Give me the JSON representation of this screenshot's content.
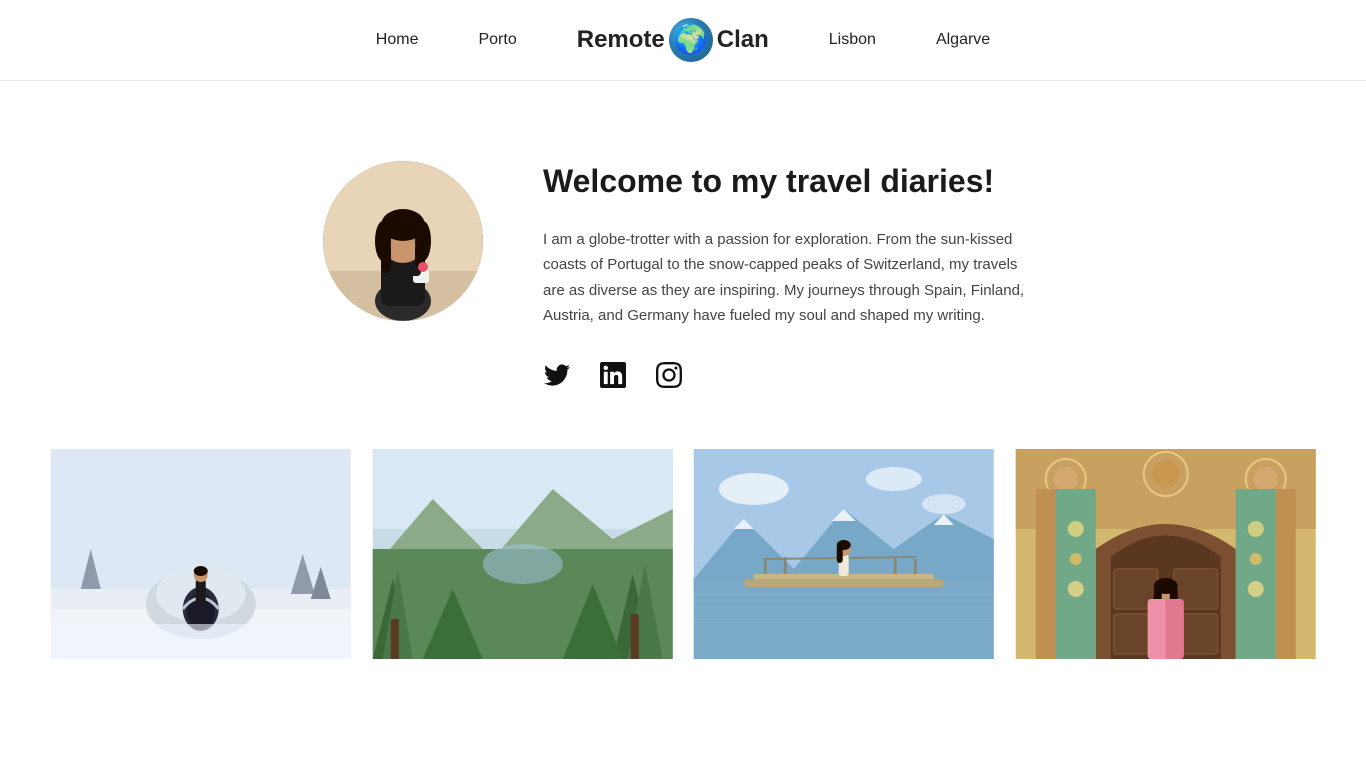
{
  "nav": {
    "links": [
      {
        "id": "home",
        "label": "Home"
      },
      {
        "id": "porto",
        "label": "Porto"
      },
      {
        "id": "lisbon",
        "label": "Lisbon"
      },
      {
        "id": "algarve",
        "label": "Algarve"
      }
    ],
    "logo": {
      "text_remote": "Remote",
      "text_clan": "Clan",
      "globe_emoji": "🌍"
    }
  },
  "hero": {
    "title": "Welcome to my travel diaries!",
    "description": "I am a globe-trotter with a passion for exploration. From the sun-kissed coasts of Portugal to the snow-capped peaks of Switzerland, my travels are as diverse as they are inspiring. My journeys through Spain, Finland, Austria, and Germany have fueled my soul and shaped my writing.",
    "social": {
      "twitter_label": "Twitter",
      "linkedin_label": "LinkedIn",
      "instagram_label": "Instagram"
    }
  },
  "photos": [
    {
      "id": "photo-1",
      "alt": "Snow scene with igloo",
      "scene": "snow"
    },
    {
      "id": "photo-2",
      "alt": "Mountain landscape",
      "scene": "mountain"
    },
    {
      "id": "photo-3",
      "alt": "Boat on water with mountains",
      "scene": "boat"
    },
    {
      "id": "photo-4",
      "alt": "Ornate architectural detail",
      "scene": "ornate"
    }
  ]
}
